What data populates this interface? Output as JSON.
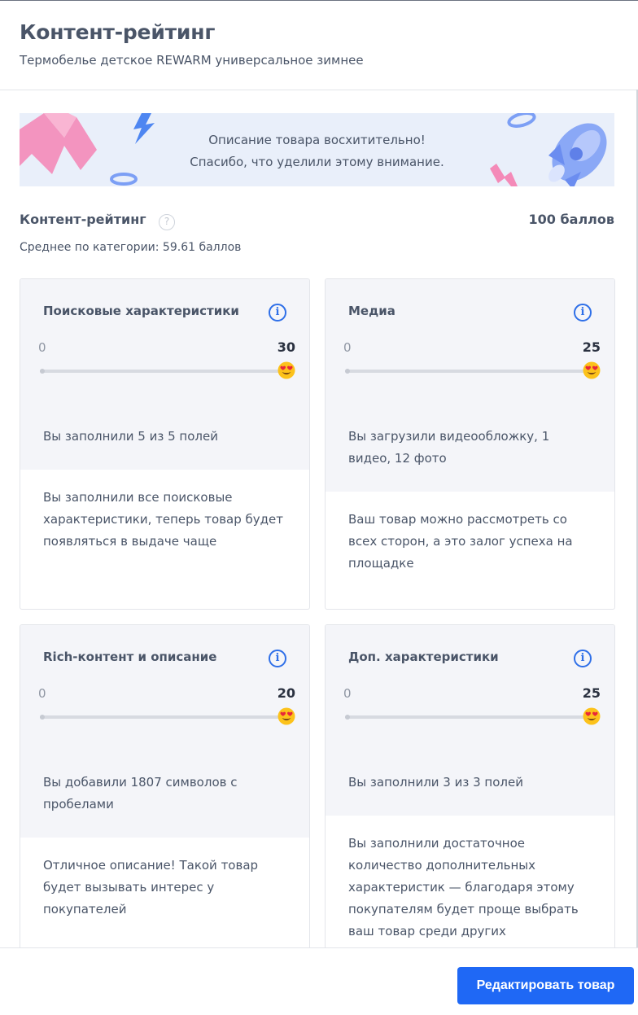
{
  "header": {
    "title": "Контент-рейтинг",
    "subtitle": "Термобелье детское REWARM универсальное зимнее"
  },
  "banner": {
    "line1": "Описание товара восхитительно!",
    "line2": "Спасибо, что уделили этому внимание."
  },
  "rating": {
    "title": "Контент-рейтинг",
    "help_glyph": "?",
    "score": "100 баллов",
    "average": "Среднее по категории: 59.61 баллов"
  },
  "cards": [
    {
      "title": "Поисковые характеристики",
      "min": "0",
      "max": "30",
      "progress": 1.0,
      "fact": "Вы заполнили 5 из 5 полей",
      "description": "Вы заполнили все поисковые характеристики, теперь товар будет появляться в выдаче чаще"
    },
    {
      "title": "Медиа",
      "min": "0",
      "max": "25",
      "progress": 1.0,
      "fact": "Вы загрузили видеообложку, 1 видео, 12 фото",
      "description": "Ваш товар можно рассмотреть со всех сторон, а это залог успеха на площадке"
    },
    {
      "title": "Rich-контент и описание",
      "min": "0",
      "max": "20",
      "progress": 1.0,
      "fact": "Вы добавили 1807 символов с пробелами",
      "description": "Отличное описание! Такой товар будет вызывать интерес у покупателей"
    },
    {
      "title": "Доп. характеристики",
      "min": "0",
      "max": "25",
      "progress": 1.0,
      "fact": "Вы заполнили 3 из 3 полей",
      "description": "Вы заполнили достаточное количество дополнительных характеристик — благодаря этому покупателям будет проще выбрать ваш товар среди других"
    }
  ],
  "icons": {
    "info": "info-icon",
    "emoji": "heart-eyes-emoji-icon",
    "help": "question-icon"
  },
  "footer": {
    "edit_label": "Редактировать товар"
  },
  "colors": {
    "accent": "#1f68f5",
    "info": "#2e6fe8",
    "card_top": "#f4f5f9",
    "banner": "#e9effa"
  }
}
